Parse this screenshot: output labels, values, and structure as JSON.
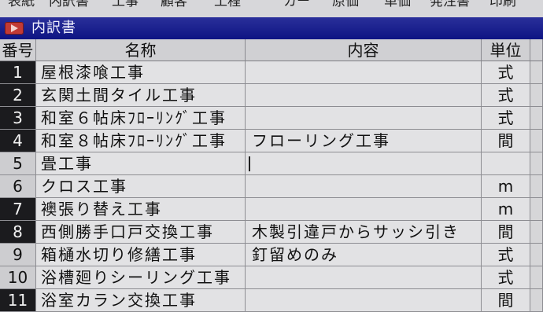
{
  "menu": [
    "表紙",
    "内訳書",
    "工事",
    "顧客",
    "工程",
    "カー",
    "原価",
    "単価",
    "発注書",
    "印刷"
  ],
  "window": {
    "title": "内訳書"
  },
  "columns": {
    "no": "番号",
    "name": "名称",
    "desc": "内容",
    "unit": "単位"
  },
  "rows": [
    {
      "no": "1",
      "name": "屋根漆喰工事",
      "desc": "",
      "unit": "式",
      "selected": true
    },
    {
      "no": "2",
      "name": "玄関土間タイル工事",
      "desc": "",
      "unit": "式",
      "selected": true
    },
    {
      "no": "3",
      "name": "和室６帖床ﾌﾛｰﾘﾝｸﾞ工事",
      "desc": "",
      "unit": "式",
      "selected": true
    },
    {
      "no": "4",
      "name": "和室８帖床ﾌﾛｰﾘﾝｸﾞ工事",
      "desc": "フローリング工事",
      "unit": "間",
      "selected": true
    },
    {
      "no": "5",
      "name": "畳工事",
      "desc": "",
      "unit": "",
      "selected": false
    },
    {
      "no": "6",
      "name": "クロス工事",
      "desc": "",
      "unit": "m",
      "selected": false
    },
    {
      "no": "7",
      "name": "襖張り替え工事",
      "desc": "",
      "unit": "m",
      "selected": true
    },
    {
      "no": "8",
      "name": "西側勝手口戸交換工事",
      "desc": "木製引違戸からサッシ引き",
      "unit": "間",
      "selected": true
    },
    {
      "no": "9",
      "name": "箱樋水切り修繕工事",
      "desc": "釘留めのみ",
      "unit": "式",
      "selected": false
    },
    {
      "no": "10",
      "name": "浴槽廻りシーリング工事",
      "desc": "",
      "unit": "式",
      "selected": false
    },
    {
      "no": "11",
      "name": "浴室カラン交換工事",
      "desc": "",
      "unit": "間",
      "selected": true
    }
  ]
}
